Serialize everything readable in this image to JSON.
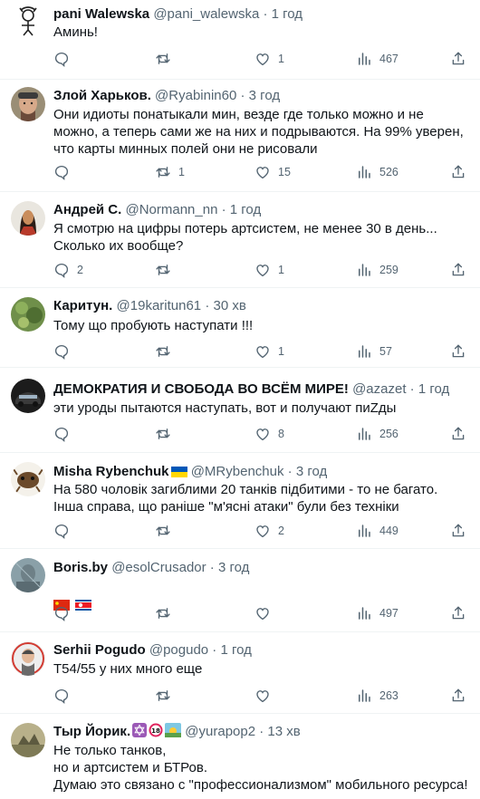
{
  "tweets": [
    {
      "name": "pani Walewska",
      "handle": "@pani_walewska",
      "sep": "·",
      "time": "1 год",
      "text": "Аминь!",
      "reply": "",
      "retweet": "",
      "like": "1",
      "views": "467"
    },
    {
      "name": "Злой Харьков.",
      "handle": "@Ryabinin60",
      "sep": "·",
      "time": "3 год",
      "text": "Они идиоты понатыкали мин, везде где только можно и не можно, а теперь сами же на них и подрываются. На 99% уверен, что карты минных полей они не рисовали",
      "reply": "",
      "retweet": "1",
      "like": "15",
      "views": "526"
    },
    {
      "name": "Андрей С.",
      "handle": "@Normann_nn",
      "sep": "·",
      "time": "1 год",
      "text": "Я смотрю на цифры потерь артсистем,  не менее 30 в день... Сколько их вообще?",
      "reply": "2",
      "retweet": "",
      "like": "1",
      "views": "259"
    },
    {
      "name": "Каритун.",
      "handle": "@19karitun61",
      "sep": "·",
      "time": "30 хв",
      "text": "Тому що пробують наступати !!!",
      "reply": "",
      "retweet": "",
      "like": "1",
      "views": "57"
    },
    {
      "name": "ДЕМОКРАТИЯ И СВОБОДА ВО ВСЁМ МИРЕ!",
      "handle": "@azazet",
      "sep": "·",
      "time": "1 год",
      "text": "эти уроды пытаются наступать, вот и получают пиZды",
      "reply": "",
      "retweet": "",
      "like": "8",
      "views": "256"
    },
    {
      "name": "Misha Rybenchuk",
      "handle": "@MRybenchuk",
      "sep": "·",
      "time": "3 год",
      "text": "На 580 чоловік загиблими 20 танків підбитими - то не багато. Інша справа, що раніше \"м'ясні атаки\" були без техніки",
      "reply": "",
      "retweet": "",
      "like": "2",
      "views": "449"
    },
    {
      "name": "Boris.by",
      "handle": "@esolCrusador",
      "sep": "·",
      "time": "3 год",
      "text": "",
      "reply": "",
      "retweet": "",
      "like": "",
      "views": "497"
    },
    {
      "name": "Serhii Pogudo",
      "handle": "@pogudo",
      "sep": "·",
      "time": "1 год",
      "text": "T54/55 у них много еще",
      "reply": "",
      "retweet": "",
      "like": "",
      "views": "263"
    },
    {
      "name": "Тыр Йорик.",
      "handle": "@yurapop2",
      "sep": "·",
      "time": "13 хв",
      "text": "Не только танков,\nно и артсистем и БТРов.\nДумаю это связано с \"профессионализмом\" мобильного ресурса!",
      "reply": "",
      "retweet": "",
      "like": "",
      "views": ""
    }
  ],
  "colors": {
    "text": "#0f1419",
    "muted": "#536471",
    "divider": "#eff3f4"
  }
}
